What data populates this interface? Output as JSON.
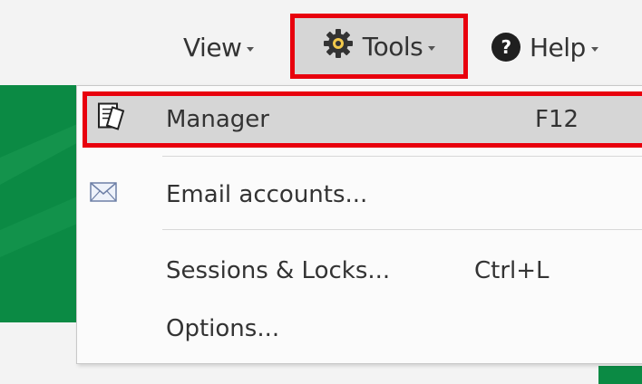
{
  "toolbar": {
    "view_label": "View",
    "tools_label": "Tools",
    "help_label": "Help",
    "help_glyph": "?"
  },
  "menu": {
    "items": [
      {
        "label": "Manager",
        "shortcut": "F12",
        "icon": "manager-cards-icon",
        "highlighted": true
      },
      {
        "label": "Email accounts...",
        "shortcut": "",
        "icon": "envelope-icon"
      },
      {
        "label": "Sessions & Locks...",
        "shortcut": "Ctrl+L",
        "icon": ""
      },
      {
        "label": "Options...",
        "shortcut": "",
        "icon": ""
      }
    ]
  },
  "colors": {
    "highlight_border": "#e8000d",
    "highlight_fill": "#d6d6d6",
    "green_panel": "#0b8a44"
  }
}
